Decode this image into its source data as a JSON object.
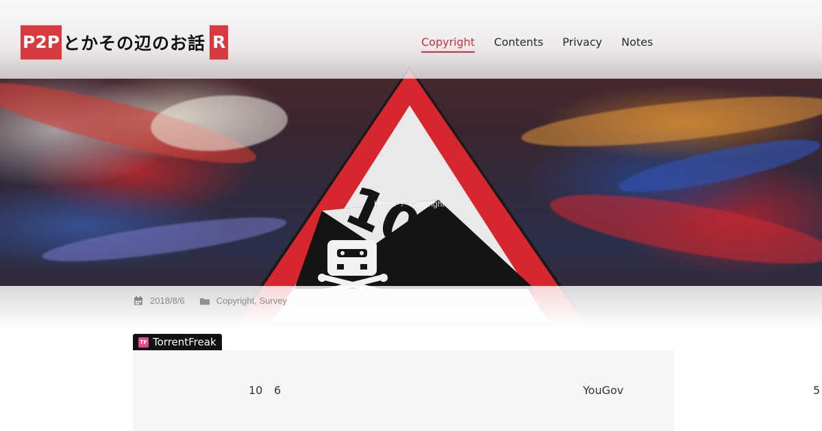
{
  "site": {
    "logo_mark": "P2P",
    "logo_title": "とかその辺のお話",
    "logo_suffix": "R"
  },
  "nav": {
    "items": [
      {
        "label": "Copyright",
        "active": true
      },
      {
        "label": "Contents",
        "active": false
      },
      {
        "label": "Privacy",
        "active": false
      },
      {
        "label": "Notes",
        "active": false
      }
    ]
  },
  "hero": {
    "sign_text": "10%",
    "sign_icon": "pirate-cassette-skull-icon"
  },
  "breadcrumb": {
    "home": "Home",
    "separator": "/",
    "current": "Copyright"
  },
  "post": {
    "date": "2018/8/6",
    "categories": "Copyright, Survey",
    "date_icon": "calendar-icon",
    "category_icon": "folder-icon"
  },
  "source": {
    "icon_text": "TF",
    "name": "TorrentFreak"
  },
  "quote": {
    "fragment_1": "10",
    "fragment_2": "6",
    "fragment_3": "YouGov",
    "fragment_4": "5"
  },
  "colors": {
    "accent": "#c8303a",
    "logo_red": "#d93a3f",
    "badge_bg": "#111111",
    "tf_pink": "#e8498a"
  }
}
